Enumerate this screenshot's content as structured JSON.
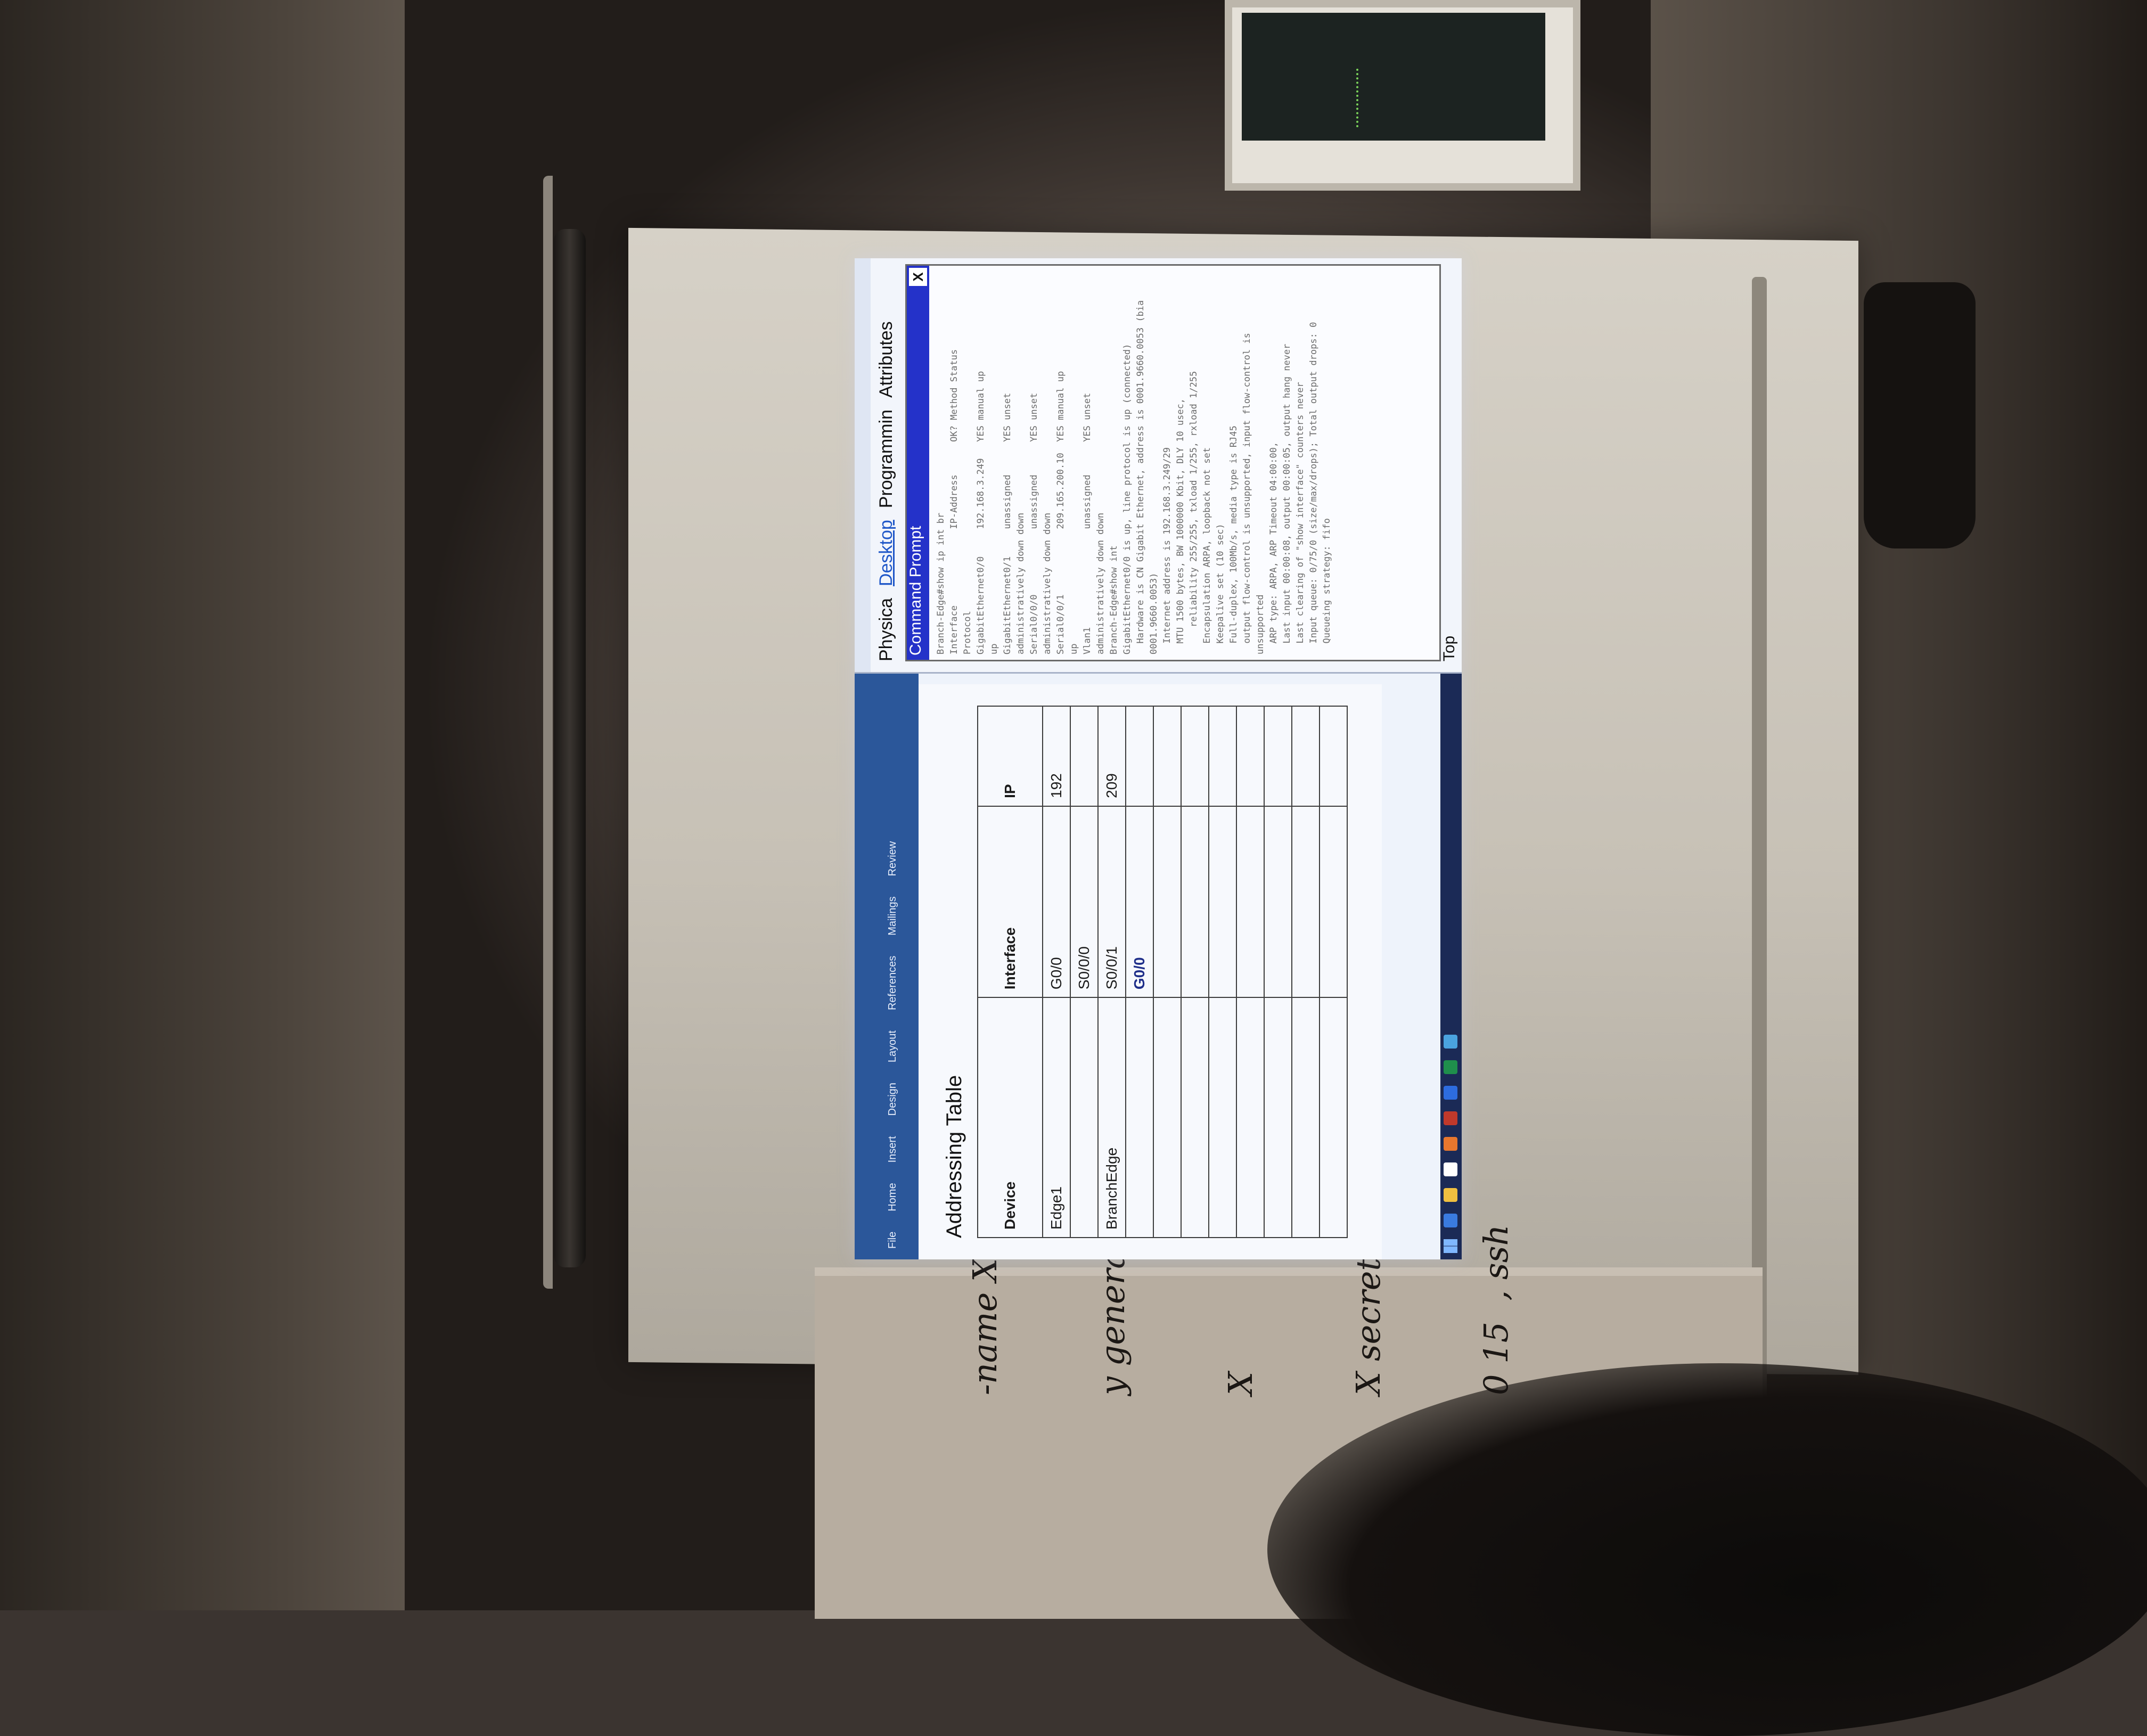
{
  "word_doc": {
    "title_bar": "",
    "ribbon_tabs": [
      "File",
      "Home",
      "Insert",
      "Design",
      "Layout",
      "References",
      "Mailings",
      "Review"
    ],
    "heading": "Addressing Table",
    "table": {
      "columns": [
        "Device",
        "Interface",
        "IP"
      ],
      "rows": [
        [
          "Edge1",
          "G0/0",
          "192"
        ],
        [
          "",
          "S0/0/0",
          ""
        ],
        [
          "BranchEdge",
          "S0/0/1",
          "209"
        ],
        [
          "",
          "G0/0",
          ""
        ],
        [
          "",
          "",
          ""
        ],
        [
          "",
          "",
          ""
        ],
        [
          "",
          "",
          ""
        ],
        [
          "",
          "",
          ""
        ],
        [
          "",
          "",
          ""
        ],
        [
          "",
          "",
          ""
        ],
        [
          "",
          "",
          ""
        ]
      ]
    }
  },
  "packet_tracer": {
    "tabs": [
      "Physica",
      "Desktop",
      "Programmin",
      "Attributes"
    ],
    "active_tab": "Desktop",
    "cmd_title": "Command Prompt",
    "close_label": "X",
    "cmd_lines": [
      "Branch-Edge#show ip int br",
      "Interface              IP-Address      OK? Method Status",
      "Protocol",
      "GigabitEthernet0/0     192.168.3.249   YES manual up",
      "up",
      "GigabitEthernet0/1     unassigned      YES unset",
      "administratively down down",
      "Serial0/0/0            unassigned      YES unset",
      "administratively down down",
      "Serial0/0/1            209.165.200.10  YES manual up",
      "up",
      "Vlan1                  unassigned      YES unset",
      "administratively down down",
      "Branch-Edge#show int",
      "GigabitEthernet0/0 is up, line protocol is up (connected)",
      "  Hardware is CN Gigabit Ethernet, address is 0001.9660.0053 (bia",
      "0001.9660.0053)",
      "  Internet address is 192.168.3.249/29",
      "  MTU 1500 bytes, BW 1000000 Kbit, DLY 10 usec,",
      "     reliability 255/255, txload 1/255, rxload 1/255",
      "  Encapsulation ARPA, loopback not set",
      "  Keepalive set (10 sec)",
      "  Full-duplex, 100Mb/s, media type is RJ45",
      "  output flow-control is unsupported, input flow-control is",
      "unsupported",
      "  ARP type: ARPA, ARP Timeout 04:00:00,",
      "  Last input 00:00:08, output 00:00:05, output hang never",
      "  Last clearing of \"show interface\" counters never",
      "  Input queue: 0/75/0 (size/max/drops); Total output drops: 0",
      "  Queueing strategy: fifo"
    ],
    "top_label": "Top"
  },
  "whiteboard_notes": [
    "-name X",
    "y generate",
    "X",
    "X secret X",
    "0 15  , ssh"
  ]
}
